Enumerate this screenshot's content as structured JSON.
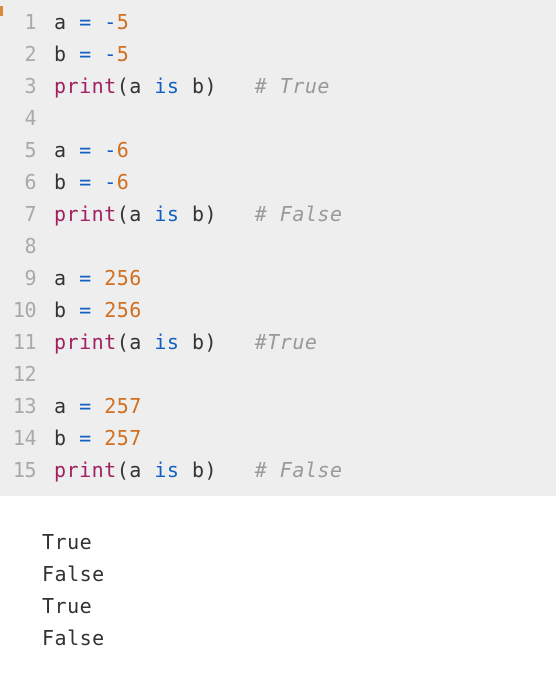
{
  "code": {
    "lines": [
      {
        "n": "1",
        "tokens": [
          {
            "t": "a",
            "c": "id"
          },
          {
            "t": " ",
            "c": "sp"
          },
          {
            "t": "=",
            "c": "op"
          },
          {
            "t": " ",
            "c": "sp"
          },
          {
            "t": "-",
            "c": "op"
          },
          {
            "t": "5",
            "c": "num"
          }
        ]
      },
      {
        "n": "2",
        "tokens": [
          {
            "t": "b",
            "c": "id"
          },
          {
            "t": " ",
            "c": "sp"
          },
          {
            "t": "=",
            "c": "op"
          },
          {
            "t": " ",
            "c": "sp"
          },
          {
            "t": "-",
            "c": "op"
          },
          {
            "t": "5",
            "c": "num"
          }
        ]
      },
      {
        "n": "3",
        "tokens": [
          {
            "t": "print",
            "c": "call"
          },
          {
            "t": "(",
            "c": "paren"
          },
          {
            "t": "a",
            "c": "id"
          },
          {
            "t": " ",
            "c": "sp"
          },
          {
            "t": "is",
            "c": "kw"
          },
          {
            "t": " ",
            "c": "sp"
          },
          {
            "t": "b",
            "c": "id"
          },
          {
            "t": ")",
            "c": "paren"
          },
          {
            "t": "   ",
            "c": "sp"
          },
          {
            "t": "# True",
            "c": "cmt"
          }
        ]
      },
      {
        "n": "4",
        "tokens": []
      },
      {
        "n": "5",
        "tokens": [
          {
            "t": "a",
            "c": "id"
          },
          {
            "t": " ",
            "c": "sp"
          },
          {
            "t": "=",
            "c": "op"
          },
          {
            "t": " ",
            "c": "sp"
          },
          {
            "t": "-",
            "c": "op"
          },
          {
            "t": "6",
            "c": "num"
          }
        ]
      },
      {
        "n": "6",
        "tokens": [
          {
            "t": "b",
            "c": "id"
          },
          {
            "t": " ",
            "c": "sp"
          },
          {
            "t": "=",
            "c": "op"
          },
          {
            "t": " ",
            "c": "sp"
          },
          {
            "t": "-",
            "c": "op"
          },
          {
            "t": "6",
            "c": "num"
          }
        ]
      },
      {
        "n": "7",
        "tokens": [
          {
            "t": "print",
            "c": "call"
          },
          {
            "t": "(",
            "c": "paren"
          },
          {
            "t": "a",
            "c": "id"
          },
          {
            "t": " ",
            "c": "sp"
          },
          {
            "t": "is",
            "c": "kw"
          },
          {
            "t": " ",
            "c": "sp"
          },
          {
            "t": "b",
            "c": "id"
          },
          {
            "t": ")",
            "c": "paren"
          },
          {
            "t": "   ",
            "c": "sp"
          },
          {
            "t": "# False",
            "c": "cmt"
          }
        ]
      },
      {
        "n": "8",
        "tokens": []
      },
      {
        "n": "9",
        "tokens": [
          {
            "t": "a",
            "c": "id"
          },
          {
            "t": " ",
            "c": "sp"
          },
          {
            "t": "=",
            "c": "op"
          },
          {
            "t": " ",
            "c": "sp"
          },
          {
            "t": "256",
            "c": "num"
          }
        ]
      },
      {
        "n": "10",
        "tokens": [
          {
            "t": "b",
            "c": "id"
          },
          {
            "t": " ",
            "c": "sp"
          },
          {
            "t": "=",
            "c": "op"
          },
          {
            "t": " ",
            "c": "sp"
          },
          {
            "t": "256",
            "c": "num"
          }
        ]
      },
      {
        "n": "11",
        "tokens": [
          {
            "t": "print",
            "c": "call"
          },
          {
            "t": "(",
            "c": "paren"
          },
          {
            "t": "a",
            "c": "id"
          },
          {
            "t": " ",
            "c": "sp"
          },
          {
            "t": "is",
            "c": "kw"
          },
          {
            "t": " ",
            "c": "sp"
          },
          {
            "t": "b",
            "c": "id"
          },
          {
            "t": ")",
            "c": "paren"
          },
          {
            "t": "   ",
            "c": "sp"
          },
          {
            "t": "#True",
            "c": "cmt"
          }
        ]
      },
      {
        "n": "12",
        "tokens": []
      },
      {
        "n": "13",
        "tokens": [
          {
            "t": "a",
            "c": "id"
          },
          {
            "t": " ",
            "c": "sp"
          },
          {
            "t": "=",
            "c": "op"
          },
          {
            "t": " ",
            "c": "sp"
          },
          {
            "t": "257",
            "c": "num"
          }
        ]
      },
      {
        "n": "14",
        "tokens": [
          {
            "t": "b",
            "c": "id"
          },
          {
            "t": " ",
            "c": "sp"
          },
          {
            "t": "=",
            "c": "op"
          },
          {
            "t": " ",
            "c": "sp"
          },
          {
            "t": "257",
            "c": "num"
          }
        ]
      },
      {
        "n": "15",
        "tokens": [
          {
            "t": "print",
            "c": "call"
          },
          {
            "t": "(",
            "c": "paren"
          },
          {
            "t": "a",
            "c": "id"
          },
          {
            "t": " ",
            "c": "sp"
          },
          {
            "t": "is",
            "c": "kw"
          },
          {
            "t": " ",
            "c": "sp"
          },
          {
            "t": "b",
            "c": "id"
          },
          {
            "t": ")",
            "c": "paren"
          },
          {
            "t": "   ",
            "c": "sp"
          },
          {
            "t": "# False",
            "c": "cmt"
          }
        ]
      }
    ]
  },
  "output": {
    "lines": [
      "True",
      "False",
      "True",
      "False"
    ]
  }
}
